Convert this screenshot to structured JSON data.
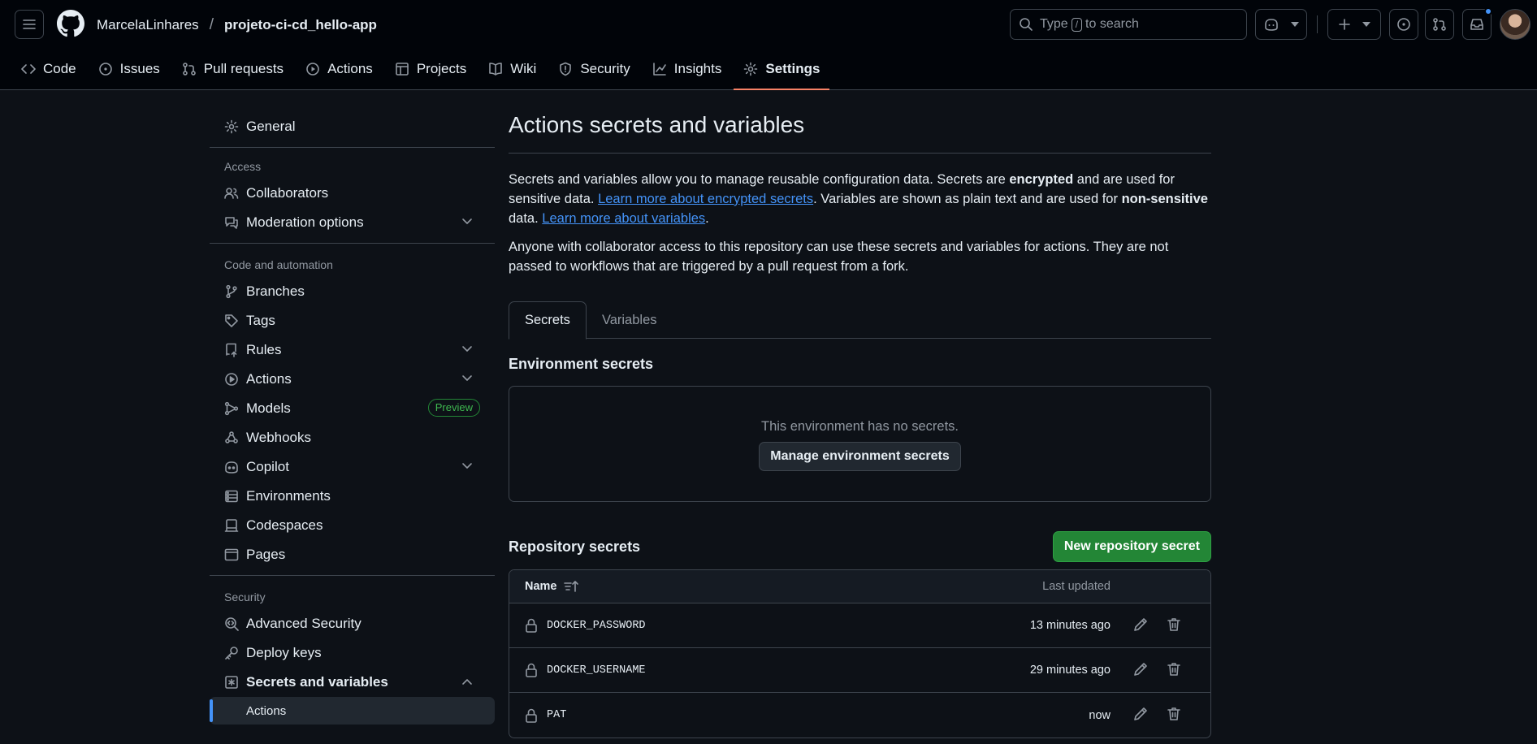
{
  "header": {
    "owner": "MarcelaLinhares",
    "separator": "/",
    "repo": "projeto-ci-cd_hello-app",
    "search_prefix": "Type",
    "search_key": "/",
    "search_suffix": "to search"
  },
  "nav": {
    "tabs": [
      "Code",
      "Issues",
      "Pull requests",
      "Actions",
      "Projects",
      "Wiki",
      "Security",
      "Insights",
      "Settings"
    ],
    "active": "Settings"
  },
  "sidebar": {
    "general": "General",
    "access_heading": "Access",
    "collaborators": "Collaborators",
    "moderation": "Moderation options",
    "code_heading": "Code and automation",
    "branches": "Branches",
    "tags": "Tags",
    "rules": "Rules",
    "actions": "Actions",
    "models": "Models",
    "models_badge": "Preview",
    "webhooks": "Webhooks",
    "copilot": "Copilot",
    "environments": "Environments",
    "codespaces": "Codespaces",
    "pages": "Pages",
    "security_heading": "Security",
    "advanced_security": "Advanced Security",
    "deploy_keys": "Deploy keys",
    "secrets_variables": "Secrets and variables",
    "sub_actions": "Actions"
  },
  "main": {
    "title": "Actions secrets and variables",
    "p1_a": "Secrets and variables allow you to manage reusable configuration data. Secrets are ",
    "p1_b": "encrypted",
    "p1_c": " and are used for sensitive data. ",
    "p1_link1": "Learn more about encrypted secrets",
    "p1_d": ". Variables are shown as plain text and are used for ",
    "p1_e": "non-sensitive",
    "p1_f": " data. ",
    "p1_link2": "Learn more about variables",
    "p1_g": ".",
    "p2": "Anyone with collaborator access to this repository can use these secrets and variables for actions. They are not passed to workflows that are triggered by a pull request from a fork.",
    "tab_secrets": "Secrets",
    "tab_variables": "Variables",
    "env_heading": "Environment secrets",
    "env_empty": "This environment has no secrets.",
    "env_button": "Manage environment secrets",
    "repo_heading": "Repository secrets",
    "new_button": "New repository secret",
    "col_name": "Name",
    "col_updated": "Last updated",
    "secrets": [
      {
        "name": "DOCKER_PASSWORD",
        "updated": "13 minutes ago"
      },
      {
        "name": "DOCKER_USERNAME",
        "updated": "29 minutes ago"
      },
      {
        "name": "PAT",
        "updated": "now"
      }
    ]
  },
  "colors": {
    "accent_underline": "#f78166",
    "link": "#4493f8",
    "primary_button": "#238636",
    "preview_badge": "#3fb950"
  }
}
